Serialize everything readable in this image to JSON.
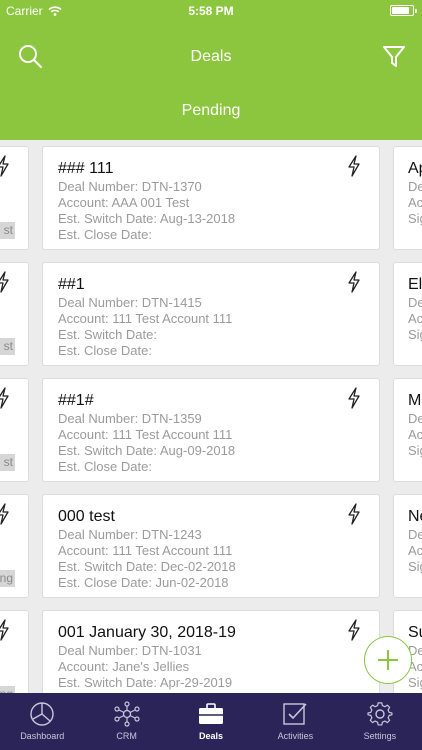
{
  "status_bar": {
    "carrier": "Carrier",
    "time": "5:58 PM"
  },
  "header": {
    "title": "Deals",
    "subtitle": "Pending"
  },
  "left_column": {
    "tags": [
      "st",
      "st",
      "st",
      "ng",
      "ng"
    ]
  },
  "deals": [
    {
      "name": "### 111",
      "deal_number": "Deal Number: DTN-1370",
      "account": "Account: AAA 001 Test",
      "switch_date": "Est. Switch Date: Aug-13-2018",
      "close_date": "Est. Close Date:"
    },
    {
      "name": "##1",
      "deal_number": "Deal Number: DTN-1415",
      "account": "Account: 111 Test Account 111",
      "switch_date": "Est. Switch Date:",
      "close_date": "Est. Close Date:"
    },
    {
      "name": "##1#",
      "deal_number": "Deal Number: DTN-1359",
      "account": "Account: 111 Test Account 111",
      "switch_date": "Est. Switch Date: Aug-09-2018",
      "close_date": "Est. Close Date:"
    },
    {
      "name": "000 test",
      "deal_number": "Deal Number: DTN-1243",
      "account": "Account: 111 Test Account 111",
      "switch_date": "Est. Switch Date: Dec-02-2018",
      "close_date": "Est. Close Date: Jun-02-2018"
    },
    {
      "name": "001 January 30, 2018-19",
      "deal_number": "Deal Number: DTN-1031",
      "account": "Account: Jane's Jellies",
      "switch_date": "Est. Switch Date: Apr-29-2019",
      "close_date": ""
    }
  ],
  "right_column": [
    {
      "name": "Ap",
      "l1": "De",
      "l2": "Ac",
      "l3": "Sig"
    },
    {
      "name": "El",
      "l1": "De",
      "l2": "Ac",
      "l3": "Sig"
    },
    {
      "name": "M",
      "l1": "De",
      "l2": "Ac",
      "l3": "Sig"
    },
    {
      "name": "Ne",
      "l1": "De",
      "l2": "Ac",
      "l3": "Sig"
    },
    {
      "name": "Su",
      "l1": "De",
      "l2": "Ac",
      "l3": "Sig"
    }
  ],
  "tabs": [
    {
      "label": "Dashboard",
      "icon": "dashboard-pie-icon"
    },
    {
      "label": "CRM",
      "icon": "crm-network-icon"
    },
    {
      "label": "Deals",
      "icon": "briefcase-icon"
    },
    {
      "label": "Activities",
      "icon": "activities-check-icon"
    },
    {
      "label": "Settings",
      "icon": "gear-icon"
    }
  ],
  "colors": {
    "header": "#8cc63f",
    "tabbar": "#2a2459",
    "accent": "#8cc63f"
  }
}
